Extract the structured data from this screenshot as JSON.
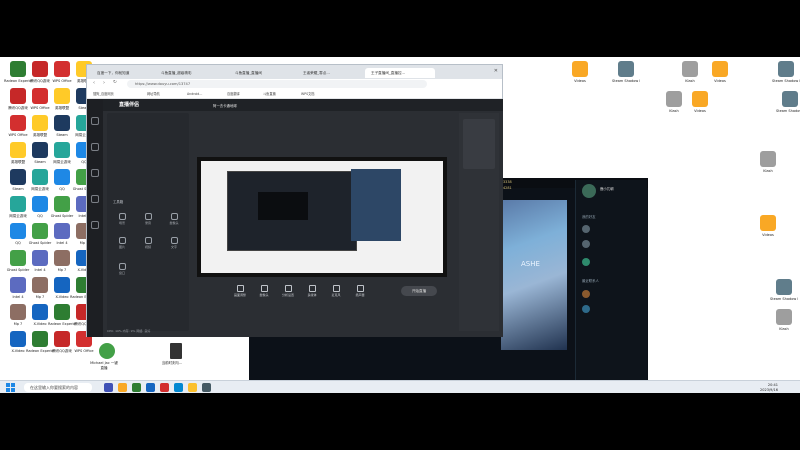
{
  "desktop": {
    "icons_left": [
      {
        "label": "Radeon Experience",
        "color": "#2e7d32"
      },
      {
        "label": "腾讯QQ游戏",
        "color": "#c62828"
      },
      {
        "label": "WPS Office",
        "color": "#d32f2f"
      },
      {
        "label": "英雄联盟",
        "color": "#ffca28"
      },
      {
        "label": "Steam",
        "color": "#1e3a5f"
      },
      {
        "label": "网易云游戏",
        "color": "#26a69a"
      },
      {
        "label": "QQ",
        "color": "#1e88e5"
      },
      {
        "label": "Ghost Spider",
        "color": "#43a047"
      },
      {
        "label": "Intel 4",
        "color": "#5c6bc0"
      },
      {
        "label": "Mp 7",
        "color": "#8d6e63"
      },
      {
        "label": "X-Video",
        "color": "#1565c0"
      }
    ],
    "icons_right": [
      {
        "label": "Videos",
        "color": "#f9a825"
      },
      {
        "label": "Steam Shadow Pe",
        "color": "#607d8b"
      },
      {
        "label": "Klash",
        "color": "#9e9e9e"
      }
    ],
    "dock_labels": [
      "Michael Jac 一键直播",
      "当前时刻与..."
    ]
  },
  "taskbar": {
    "search_placeholder": "在这里输入你要搜索的内容",
    "time": "20:41",
    "date": "2023/9/16"
  },
  "browser": {
    "tabs": [
      {
        "label": "百度一下，你就知道"
      },
      {
        "label": "斗鱼直播_超级精彩"
      },
      {
        "label": "斗鱼直播_直播间"
      },
      {
        "label": "王者荣耀_零点..."
      },
      {
        "label": "王子直播间_直播控..."
      }
    ],
    "url": "https://www.douyu.com/13747",
    "bookmarks": [
      "搜狗_百度网页",
      "网址导航",
      "Android...",
      "百度翻译",
      "斗鱼直播",
      "WPS文档"
    ]
  },
  "douyu": {
    "logo": "直播伴侣",
    "room_title": "阿一去卡通地球",
    "left_nav": [
      "首页",
      "直播",
      "动态",
      "我的",
      "设置"
    ],
    "panel": {
      "title": "工具箱",
      "tools": [
        {
          "label": "场景",
          "color": "#9aa0a8"
        },
        {
          "label": "录音",
          "color": "#9aa0a8"
        },
        {
          "label": "摄像头",
          "color": "#9aa0a8"
        },
        {
          "label": "图片",
          "color": "#9aa0a8"
        },
        {
          "label": "视频",
          "color": "#9aa0a8"
        },
        {
          "label": "文字",
          "color": "#9aa0a8"
        },
        {
          "label": "窗口",
          "color": "#9aa0a8"
        }
      ]
    },
    "toolbar": [
      {
        "label": "画面调整"
      },
      {
        "label": "摄像头"
      },
      {
        "label": "分析设置"
      },
      {
        "label": "多媒体"
      },
      {
        "label": "麦克风"
      },
      {
        "label": "扬声器"
      }
    ],
    "start_label": "开始直播",
    "status_line": "CPU: 10%  内存: 9%  网络: 良好"
  },
  "game": {
    "gold": "3338",
    "kills": "4281",
    "chat_names": [
      "我的好友",
      "鹿小兀朝",
      "最近联系人"
    ],
    "hero_name": "ASHE"
  }
}
